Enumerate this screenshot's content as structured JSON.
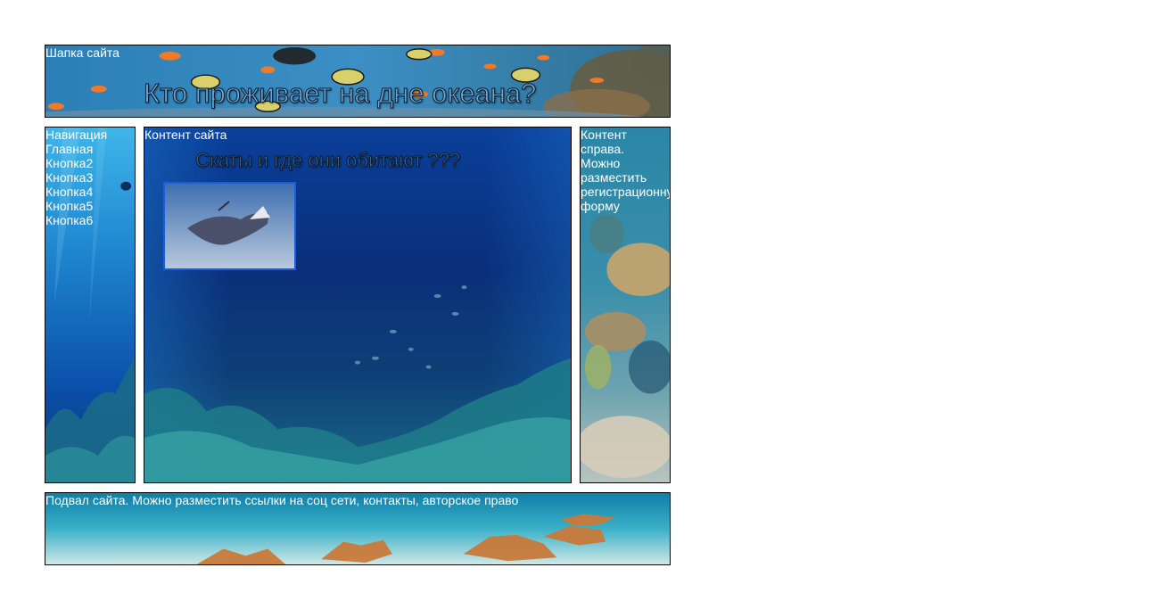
{
  "header": {
    "label": "Шапка сайта",
    "title": "Кто проживает на дне океана?"
  },
  "nav": {
    "label": "Навигация",
    "items": [
      {
        "label": "Главная"
      },
      {
        "label": "Кнопка2"
      },
      {
        "label": "Кнопка3"
      },
      {
        "label": "Кнопка4"
      },
      {
        "label": "Кнопка5"
      },
      {
        "label": "Кнопка6"
      }
    ]
  },
  "content": {
    "label": "Контент сайта",
    "heading": "Скаты и где они обитают ???",
    "image_icon": "stingray-photo"
  },
  "right": {
    "lines": [
      "Контент",
      "справа.",
      "Можно",
      "разместить",
      "регистрационную",
      "форму"
    ]
  },
  "footer": {
    "label": "Подвал сайта. Можно разместить ссылки на соц сети, контакты, авторское право"
  },
  "colors": {
    "border": "#000000",
    "text": "#ffffff",
    "photo_border": "#1a5ee0",
    "ocean_deep": "#0a2f7a",
    "ocean_light": "#2aa0d8"
  }
}
